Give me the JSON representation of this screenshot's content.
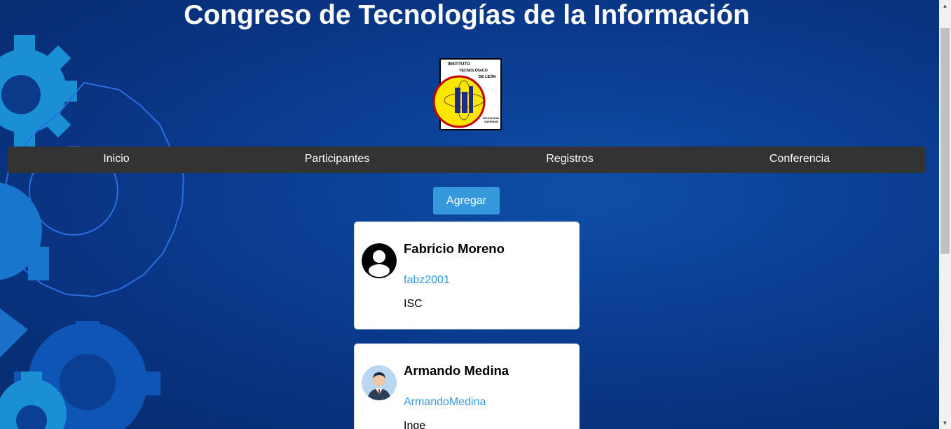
{
  "page": {
    "title": "Congreso de Tecnologías de la Información",
    "logo_text": [
      "INSTITUTO",
      "TECNOLÓGICO",
      "DE LEÓN",
      "EDUCACIÓN",
      "SUPERIOR",
      "CIENCIA, TECNOLOGÍA Y LIBERTAD"
    ]
  },
  "nav": {
    "items": [
      {
        "label": "Inicio"
      },
      {
        "label": "Participantes"
      },
      {
        "label": "Registros"
      },
      {
        "label": "Conferencia"
      }
    ]
  },
  "actions": {
    "add_label": "Agregar"
  },
  "participants": [
    {
      "name": "Fabricio Moreno",
      "username": "fabz2001",
      "career": "ISC",
      "avatar": "generic-user-icon"
    },
    {
      "name": "Armando Medina",
      "username": "ArmandoMedina",
      "career": "Inge",
      "avatar": "businessman-avatar"
    }
  ],
  "colors": {
    "background": "#0b3f94",
    "navbar": "#333333",
    "accent": "#3498db",
    "card": "#ffffff"
  }
}
